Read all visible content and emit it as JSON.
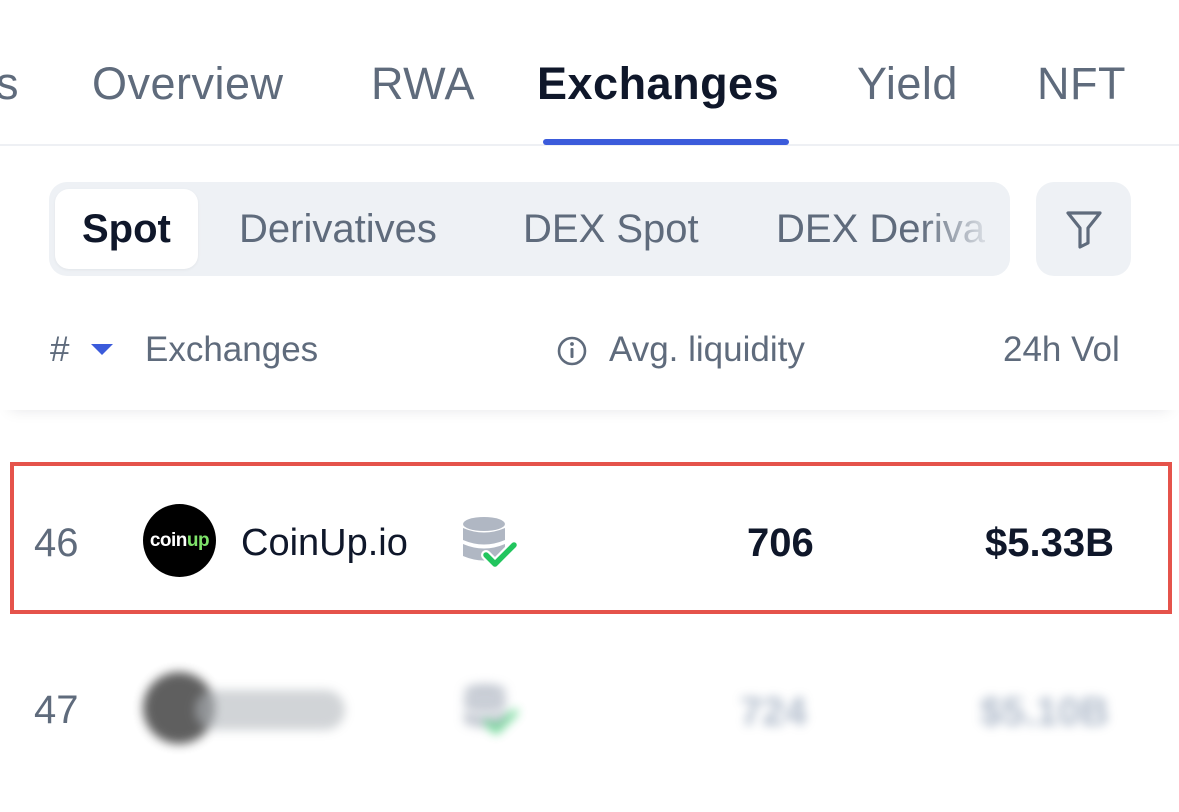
{
  "nav": {
    "tabs": [
      {
        "label": "s"
      },
      {
        "label": "Overview"
      },
      {
        "label": "RWA"
      },
      {
        "label": "Exchanges",
        "active": true
      },
      {
        "label": "Yield"
      },
      {
        "label": "NFT"
      }
    ]
  },
  "subtabs": {
    "items": [
      {
        "label": "Spot",
        "active": true
      },
      {
        "label": "Derivatives"
      },
      {
        "label": "DEX Spot"
      },
      {
        "label": "DEX Deriva"
      }
    ],
    "filter_icon": "filter-icon"
  },
  "table": {
    "headers": {
      "rank": "#",
      "exchange": "Exchanges",
      "liquidity": "Avg. liquidity",
      "volume": "24h Vol"
    },
    "rows": [
      {
        "rank": "46",
        "logo_text": "coin",
        "logo_accent": "up",
        "name": "CoinUp.io",
        "verified_icon": "database-check-icon",
        "liquidity": "706",
        "volume": "$5.33B",
        "highlighted": true
      },
      {
        "rank": "47",
        "name": "",
        "liquidity": "724",
        "volume": "$5.10B",
        "blurred": true
      }
    ]
  },
  "colors": {
    "accent": "#3b5bdb",
    "highlight": "#e5534b",
    "verified": "#22c55e"
  }
}
